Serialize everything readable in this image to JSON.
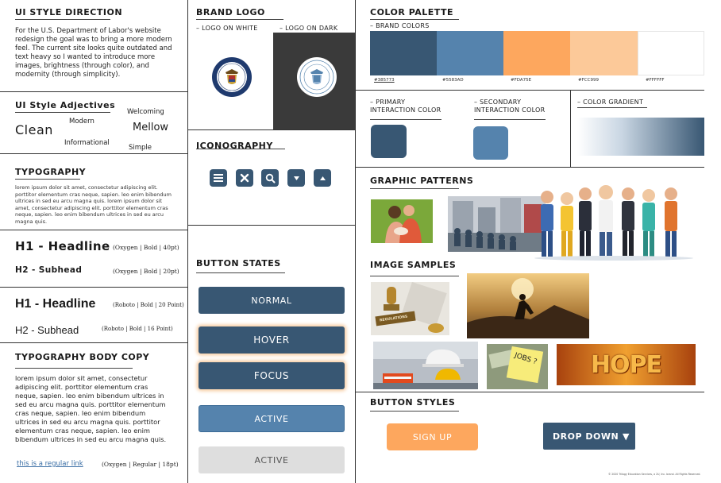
{
  "style_direction": {
    "title": "UI STYLE DIRECTION",
    "body": "For the U.S. Department of Labor's website redesign the goal was to bring a more modern feel. The current site looks quite outdated and text heavy so I wanted to introduce more images, brightness (through color), and modernity (through simplicity)."
  },
  "adjectives": {
    "title": "UI Style Adjectives",
    "clean": "Clean",
    "modern": "Modern",
    "welcoming": "Welcoming",
    "mellow": "Mellow",
    "informational": "Informational",
    "simple": "Simple"
  },
  "typography": {
    "title": "TYPOGRAPHY",
    "sample": "lorem ipsum dolor sit amet, consectetur adipiscing elit. porttitor elementum cras neque, sapien. leo enim bibendum ultrices in sed eu arcu magna quis. lorem ipsum dolor sit amet, consectetur adipiscing elit. porttitor elementum cras neque, sapien. leo enim bibendum ultrices in sed eu arcu magna quis.",
    "h1_oxygen": "H1 - Headline",
    "h1_oxygen_spec": "(Oxygen | Bold | 40pt)",
    "h2_oxygen": "H2 - Subhead",
    "h2_oxygen_spec": "(Oxygen | Bold | 20pt)",
    "h1_roboto": "H1 - Headline",
    "h1_roboto_spec": "(Roboto | Bold | 20 Point)",
    "h2_roboto": "H2 - Subhead",
    "h2_roboto_spec": "(Roboto | Bold | 16 Point)"
  },
  "body_copy": {
    "title": "TYPOGRAPHY BODY COPY",
    "text": "lorem ipsum dolor sit amet, consectetur adipiscing elit. porttitor elementum cras neque, sapien. leo enim bibendum ultrices in sed eu arcu magna quis. porttitor elementum cras neque, sapien. leo enim bibendum ultrices in sed eu arcu magna quis. porttitor elementum cras neque, sapien. leo enim bibendum ultrices in sed eu arcu magna quis.",
    "link": "this is a regular link",
    "spec": "(Oxygen | Regular | 18pt)"
  },
  "brand_logo": {
    "title": "BRAND LOGO",
    "on_white": "– LOGO ON WHITE",
    "on_dark": "– LOGO ON DARK"
  },
  "iconography": {
    "title": "ICONOGRAPHY",
    "icons": [
      "menu-icon",
      "close-icon",
      "search-icon",
      "caret-down-icon",
      "caret-up-icon"
    ]
  },
  "button_states": {
    "title": "BUTTON STATES",
    "normal": "NORMAL",
    "hover": "HOVER",
    "focus": "FOCUS",
    "active": "ACTIVE",
    "disabled": "ACTIVE"
  },
  "palette": {
    "title": "COLOR PALETTE",
    "brand_label": "– BRAND COLORS",
    "brand_colors": [
      "#385773",
      "#5583AD",
      "#FDA75E",
      "#FCC999",
      "#FFFFFF"
    ],
    "brand_hex_labels": [
      "#385773",
      "#5583AD",
      "#FDA75E",
      "#FCC999",
      "#FFFFFF"
    ],
    "primary_label_1": "– PRIMARY",
    "primary_label_2": "INTERACTION COLOR",
    "primary_color": "#385773",
    "secondary_label_1": "– SECONDARY",
    "secondary_label_2": "INTERACTION COLOR",
    "secondary_color": "#5583AD",
    "gradient_label": "– COLOR GRADIENT"
  },
  "patterns": {
    "title": "GRAPHIC PATTERNS"
  },
  "samples": {
    "title": "IMAGE SAMPLES",
    "hope_text": "HOPE",
    "regulations_text": "REGULATIONS",
    "jobs_text": "JOBS ?"
  },
  "button_styles": {
    "title": "BUTTON STYLES",
    "signup": "SIGN UP",
    "dropdown": "DROP DOWN",
    "dropdown_caret": "▼"
  },
  "footer": {
    "copyright": "© 2020 Trilogy Education Services, a 2U, Inc. brand. All Rights Reserved."
  },
  "colors": {
    "primary": "#385773",
    "secondary": "#5583AD",
    "orange": "#FDA75E",
    "peach": "#FCC999",
    "disabled": "#DEDEDE",
    "dark_panel": "#3A3A3A"
  }
}
